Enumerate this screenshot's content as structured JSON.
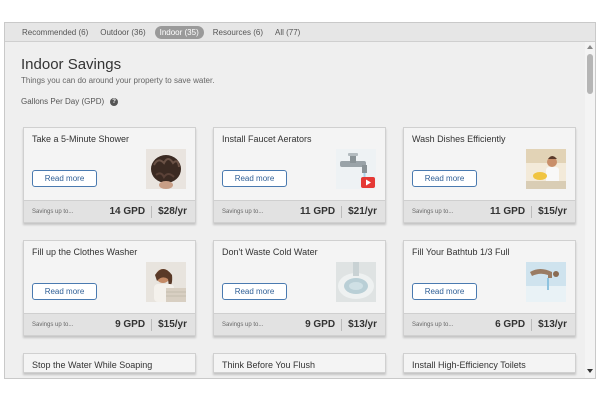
{
  "tabs": [
    {
      "label": "Recommended (6)"
    },
    {
      "label": "Outdoor (36)"
    },
    {
      "label": "Indoor (35)",
      "active": true
    },
    {
      "label": "Resources (6)"
    },
    {
      "label": "All (77)"
    }
  ],
  "header": {
    "title": "Indoor Savings",
    "subtitle": "Things you can do around your property to save water.",
    "gpd_label": "Gallons Per Day (GPD)",
    "help_icon": "?"
  },
  "cards": [
    {
      "title": "Take a 5-Minute Shower",
      "button": "Read more",
      "savings_label": "Savings up to...",
      "gpd": "14 GPD",
      "per_year": "$28/yr",
      "image": "shower-hair-photo"
    },
    {
      "title": "Install Faucet Aerators",
      "button": "Read more",
      "savings_label": "Savings up to...",
      "gpd": "11 GPD",
      "per_year": "$21/yr",
      "image": "faucet-video-thumbnail"
    },
    {
      "title": "Wash Dishes Efficiently",
      "button": "Read more",
      "savings_label": "Savings up to...",
      "gpd": "11 GPD",
      "per_year": "$15/yr",
      "image": "dishwashing-photo"
    },
    {
      "title": "Fill up the Clothes Washer",
      "button": "Read more",
      "savings_label": "Savings up to...",
      "gpd": "9 GPD",
      "per_year": "$15/yr",
      "image": "laundry-photo"
    },
    {
      "title": "Don't Waste Cold Water",
      "button": "Read more",
      "savings_label": "Savings up to...",
      "gpd": "9 GPD",
      "per_year": "$13/yr",
      "image": "water-bowl-photo"
    },
    {
      "title": "Fill Your Bathtub 1/3 Full",
      "button": "Read more",
      "savings_label": "Savings up to...",
      "gpd": "6 GPD",
      "per_year": "$13/yr",
      "image": "bathtub-faucet-photo"
    }
  ],
  "partial_cards": [
    {
      "title": "Stop the Water While Soaping"
    },
    {
      "title": "Think Before You Flush"
    },
    {
      "title": "Install High-Efficiency Toilets"
    }
  ],
  "colors": {
    "accent": "#2f5f96",
    "active_tab": "#9a9a9a"
  }
}
